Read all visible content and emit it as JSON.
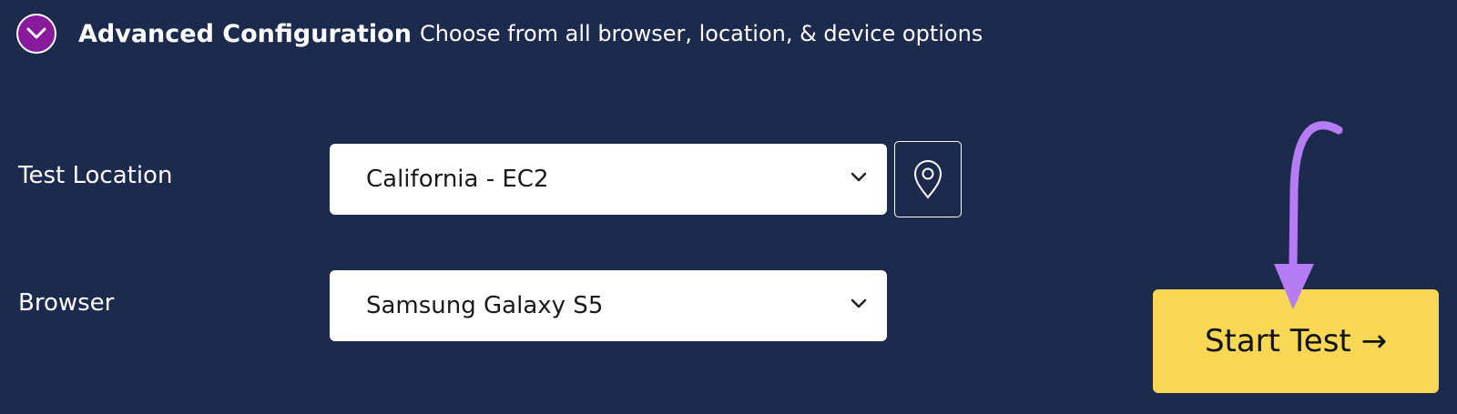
{
  "header": {
    "toggle_icon": "chevron-down-icon",
    "title": "Advanced Configuration",
    "subtitle": "Choose from all browser, location, & device options"
  },
  "test_location": {
    "label": "Test Location",
    "selected": "California - EC2",
    "pin_icon": "map-pin-icon"
  },
  "browser": {
    "label": "Browser",
    "selected": "Samsung Galaxy S5"
  },
  "start_button": {
    "label": "Start Test →"
  },
  "colors": {
    "background": "#1c2a4d",
    "toggle_accent": "#8a1a9c",
    "start_button": "#f8d755",
    "annotation_arrow": "#b57cf5"
  }
}
